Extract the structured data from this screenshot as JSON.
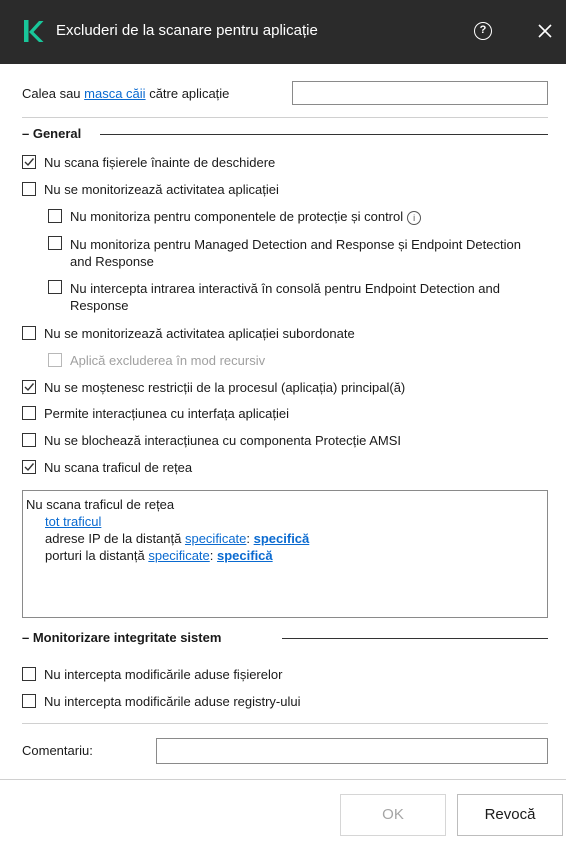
{
  "window": {
    "title": "Excluderi de la scanare pentru aplicație",
    "help_icon": "question-circle-icon",
    "close_icon": "close-icon",
    "logo_icon": "kaspersky-k-logo"
  },
  "path": {
    "label_before": "Calea sau ",
    "label_link": "masca căii",
    "label_after": " către aplicație",
    "value": ""
  },
  "general": {
    "title": "– General",
    "options": [
      {
        "label": "Nu scana fișierele înainte de deschidere",
        "checked": true
      },
      {
        "label": "Nu se monitorizează activitatea aplicației",
        "checked": false
      },
      {
        "label": "Nu monitoriza pentru componentele de protecție și control",
        "checked": false
      },
      {
        "label": "Nu monitoriza pentru Managed Detection and Response și Endpoint Detection and Response",
        "checked": false
      },
      {
        "label": "Nu intercepta intrarea interactivă în consolă pentru Endpoint Detection and Response",
        "checked": false
      },
      {
        "label": "Nu se monitorizează activitatea aplicației subordonate",
        "checked": false
      },
      {
        "label": "Aplică excluderea în mod recursiv",
        "checked": false,
        "disabled": true
      },
      {
        "label": "Nu se moștenesc restricții de la procesul (aplicația) principal(ă)",
        "checked": true
      },
      {
        "label": "Permite interacțiunea cu interfața aplicației",
        "checked": false
      },
      {
        "label": "Nu se blochează interacțiunea cu componenta Protecție AMSI",
        "checked": false
      },
      {
        "label": "Nu scana traficul de rețea",
        "checked": true
      }
    ],
    "info_icon": "info-circle-icon"
  },
  "traffic": {
    "heading": "Nu scana traficul de rețea",
    "all_traffic": "tot traficul",
    "ip_prefix": "adrese IP de la distanță ",
    "ip_link": "specificate",
    "ip_sep": ": ",
    "ip_value": "specifică",
    "ports_prefix": "porturi la distanță ",
    "ports_link": "specificate",
    "ports_sep": ": ",
    "ports_value": "specifică"
  },
  "integrity": {
    "title": "– Monitorizare integritate sistem",
    "options": [
      {
        "label": "Nu intercepta modificările aduse fișierelor",
        "checked": false
      },
      {
        "label": "Nu intercepta modificările aduse registry-ului",
        "checked": false
      }
    ]
  },
  "comment": {
    "label": "Comentariu:",
    "value": ""
  },
  "buttons": {
    "ok": "OK",
    "cancel": "Revocă"
  }
}
